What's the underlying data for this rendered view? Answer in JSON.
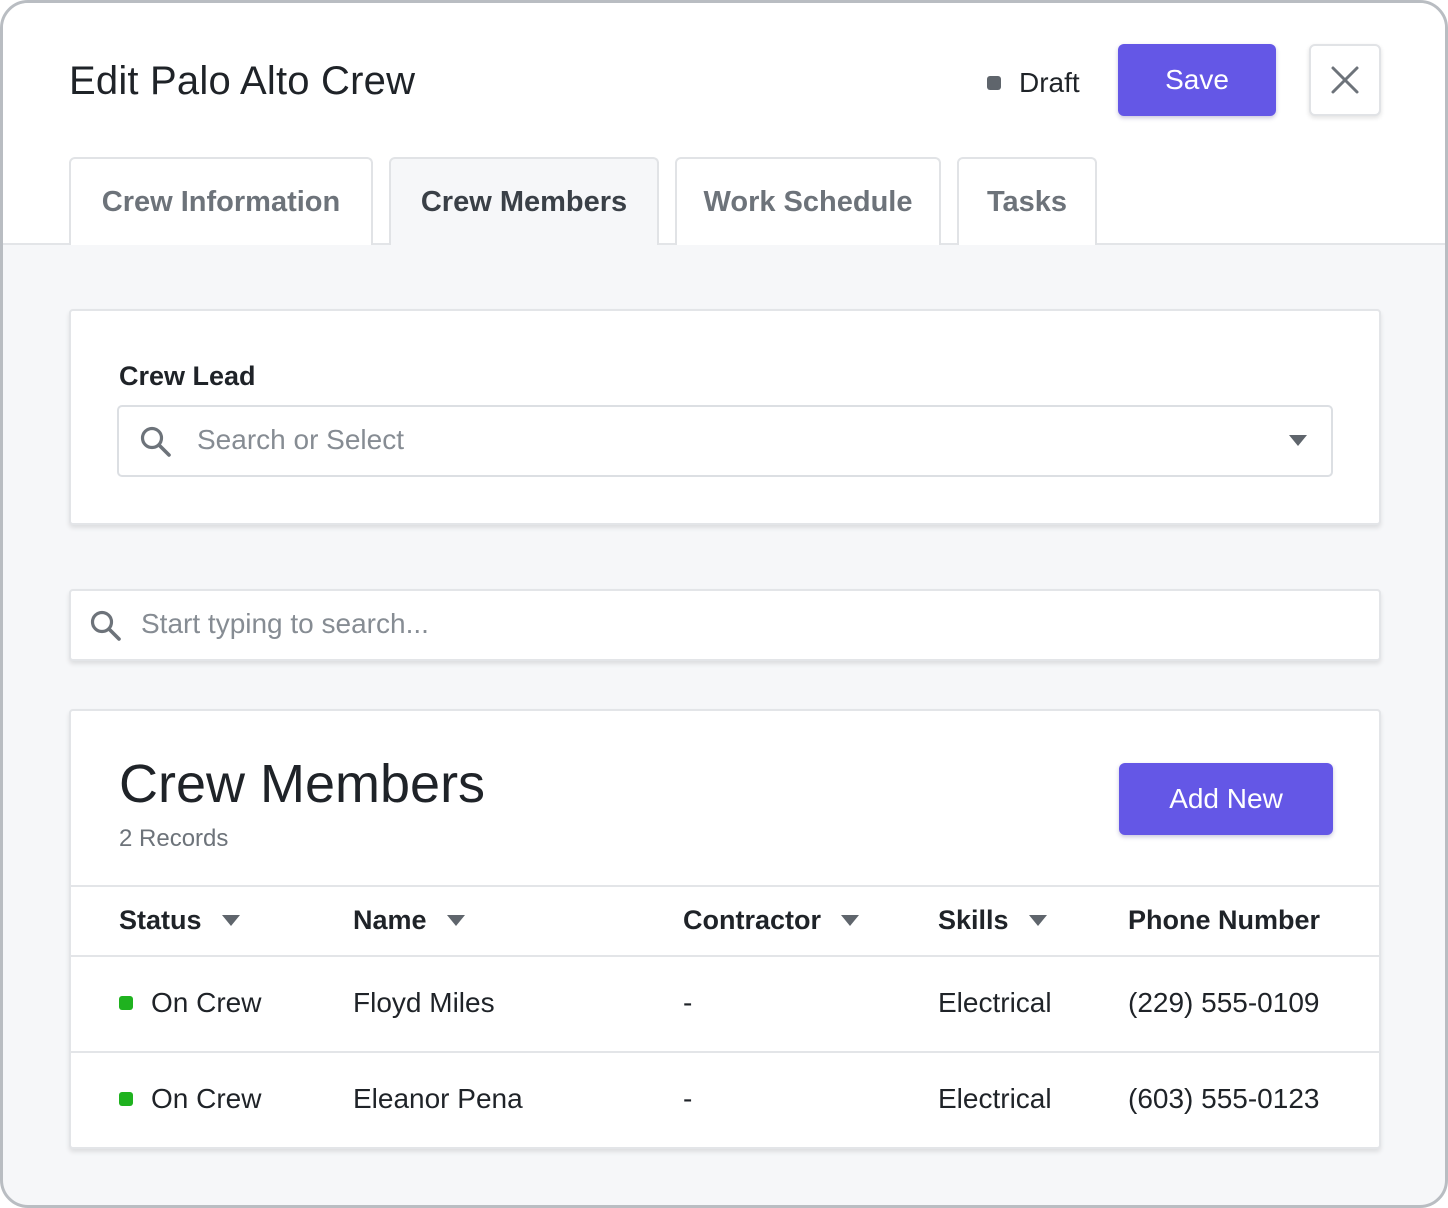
{
  "header": {
    "title": "Edit Palo Alto Crew",
    "status_label": "Draft",
    "save_label": "Save",
    "close_icon": "close-icon"
  },
  "tabs": [
    {
      "label": "Crew Information",
      "active": false
    },
    {
      "label": "Crew Members",
      "active": true
    },
    {
      "label": "Work Schedule",
      "active": false
    },
    {
      "label": "Tasks",
      "active": false
    }
  ],
  "crew_lead": {
    "label": "Crew Lead",
    "placeholder": "Search or Select",
    "icon": "search-icon"
  },
  "search": {
    "placeholder": "Start typing to search..."
  },
  "members": {
    "title": "Crew Members",
    "records": "2 Records",
    "add_label": "Add New",
    "columns": [
      "Status",
      "Name",
      "Contractor",
      "Skills",
      "Phone Number"
    ],
    "rows": [
      {
        "status": "On Crew",
        "name": "Floyd Miles",
        "contractor": "-",
        "skills": "Electrical",
        "phone": "(229) 555-0109"
      },
      {
        "status": "On Crew",
        "name": "Eleanor Pena",
        "contractor": "-",
        "skills": "Electrical",
        "phone": "(603) 555-0123"
      }
    ]
  },
  "colors": {
    "accent": "#6457e6",
    "status_on_crew": "#1fb21f",
    "draft_dot": "#5f656c"
  }
}
